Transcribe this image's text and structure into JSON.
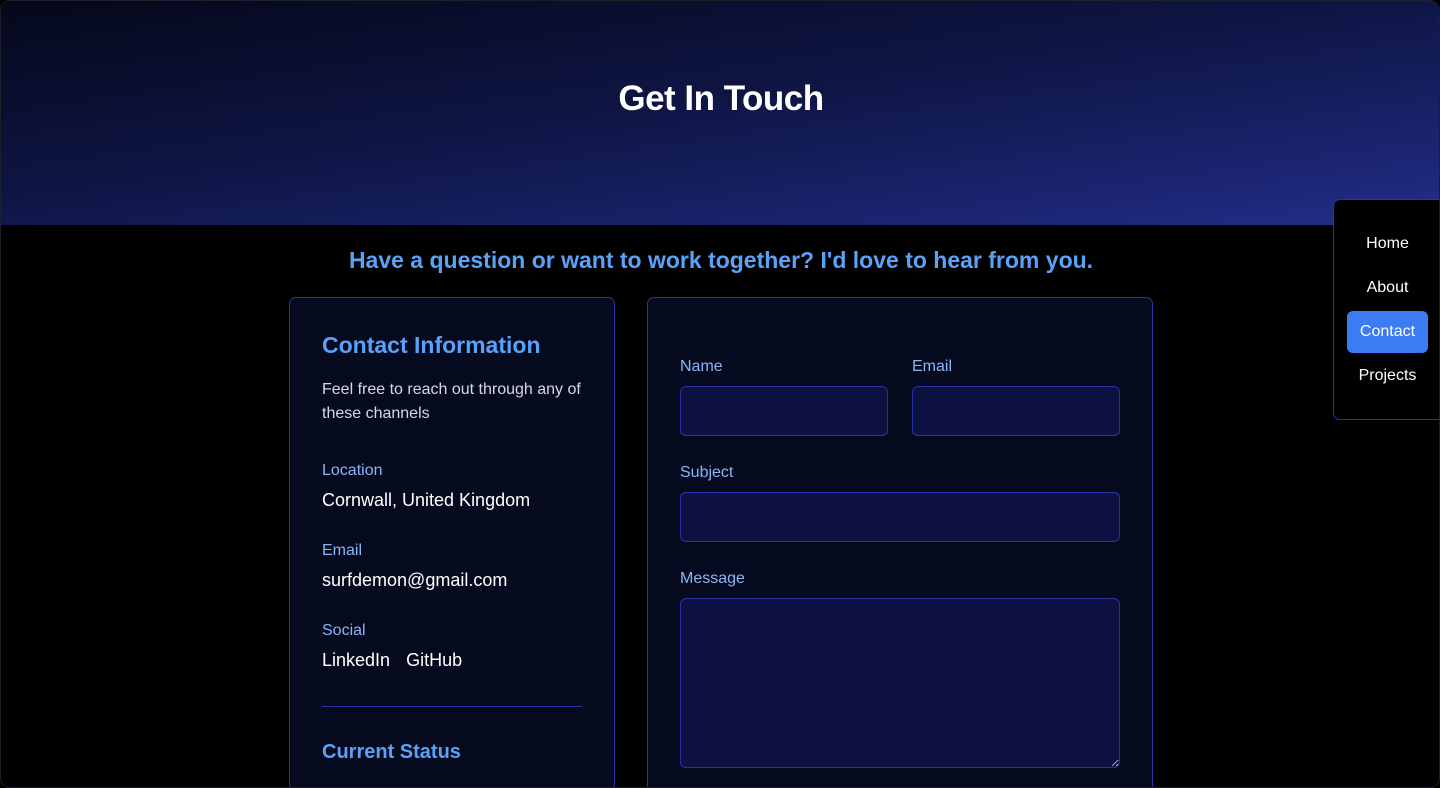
{
  "hero": {
    "title": "Get In Touch"
  },
  "tagline": "Have a question or want to work together? I'd love to hear from you.",
  "contact_info": {
    "title": "Contact Information",
    "description": "Feel free to reach out through any of these channels",
    "location_label": "Location",
    "location_value": "Cornwall, United Kingdom",
    "email_label": "Email",
    "email_value": "surfdemon@gmail.com",
    "social_label": "Social",
    "social_links": [
      "LinkedIn",
      "GitHub"
    ],
    "status_title": "Current Status"
  },
  "form": {
    "name_label": "Name",
    "email_label": "Email",
    "subject_label": "Subject",
    "message_label": "Message",
    "name_value": "",
    "email_value": "",
    "subject_value": "",
    "message_value": ""
  },
  "nav": {
    "items": [
      {
        "label": "Home"
      },
      {
        "label": "About"
      },
      {
        "label": "Contact"
      },
      {
        "label": "Projects"
      }
    ],
    "active": "Contact"
  },
  "colors": {
    "accent": "#5aa2f8",
    "label": "#8ab6f5",
    "border": "#2a33a8",
    "active_nav": "#3b7cf5",
    "card_bg": "#060a1f",
    "input_bg": "#0e1242"
  }
}
